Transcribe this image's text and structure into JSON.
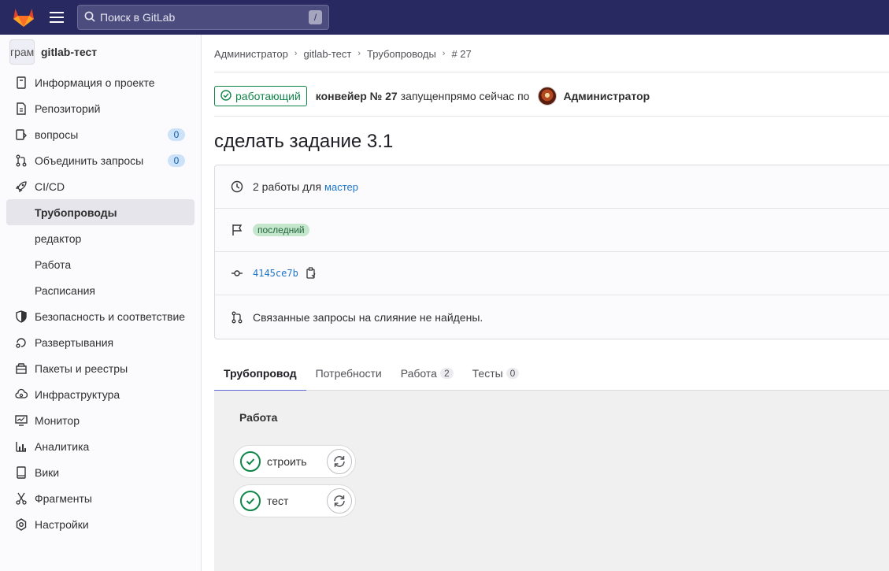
{
  "topbar": {
    "search_placeholder": "Поиск в GitLab",
    "search_shortcut": "/"
  },
  "sidebar": {
    "project_avatar_text": "грам",
    "project_name": "gitlab-тест",
    "items": [
      {
        "label": "Информация о проекте",
        "icon": "project-info-icon"
      },
      {
        "label": "Репозиторий",
        "icon": "repository-icon"
      },
      {
        "label": "вопросы",
        "icon": "issues-icon",
        "count": "0"
      },
      {
        "label": "Объединить запросы",
        "icon": "merge-request-icon",
        "count": "0"
      },
      {
        "label": "CI/CD",
        "icon": "rocket-icon"
      },
      {
        "label": "Трубопроводы",
        "active": true
      },
      {
        "label": "редактор"
      },
      {
        "label": "Работа"
      },
      {
        "label": "Расписания"
      },
      {
        "label": "Безопасность и соответствие",
        "icon": "shield-icon"
      },
      {
        "label": "Развертывания",
        "icon": "deployments-icon"
      },
      {
        "label": "Пакеты и реестры",
        "icon": "package-icon"
      },
      {
        "label": "Инфраструктура",
        "icon": "cloud-gear-icon"
      },
      {
        "label": "Монитор",
        "icon": "monitor-icon"
      },
      {
        "label": "Аналитика",
        "icon": "chart-icon"
      },
      {
        "label": "Вики",
        "icon": "book-icon"
      },
      {
        "label": "Фрагменты",
        "icon": "snippet-icon"
      },
      {
        "label": "Настройки",
        "icon": "settings-icon"
      }
    ]
  },
  "breadcrumb": [
    "Администратор",
    "gitlab-тест",
    "Трубопроводы",
    "# 27"
  ],
  "header": {
    "status": "работающий",
    "pipeline": "конвейер № 27",
    "text": "запущенпрямо сейчас по",
    "user": "Администратор"
  },
  "title": "сделать задание 3.1",
  "info": {
    "jobs_text": "2 работы для",
    "branch": "мастер",
    "latest_badge": "последний",
    "sha": "4145ce7b",
    "mr_text": "Связанные запросы на слияние не найдены."
  },
  "tabs": [
    {
      "label": "Трубопровод",
      "active": true
    },
    {
      "label": "Потребности"
    },
    {
      "label": "Работа",
      "count": "2"
    },
    {
      "label": "Тесты",
      "count": "0"
    }
  ],
  "graph": {
    "stage": "Работа",
    "jobs": [
      "строить",
      "тест"
    ]
  },
  "colors": {
    "navbar": "#292961",
    "success": "#108548",
    "link": "#1f75cb",
    "active_tab": "#6366d6"
  }
}
